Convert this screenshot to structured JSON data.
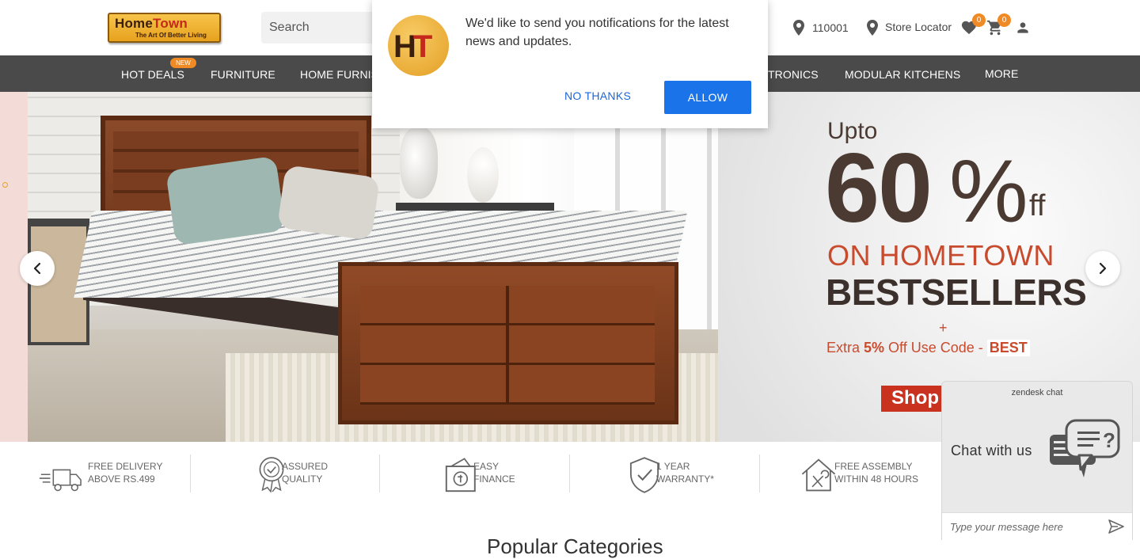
{
  "header": {
    "logo": {
      "name": "HomeTown",
      "name_part1": "Home",
      "name_part2": "Town",
      "tagline": "The Art Of Better Living"
    },
    "search_placeholder": "Search",
    "pincode": "110001",
    "store_locator": "Store Locator",
    "wishlist_count": "0",
    "cart_count": "0"
  },
  "nav": {
    "new_badge": "NEW",
    "items": [
      "HOT DEALS",
      "FURNITURE",
      "HOME FURNIS",
      "TRONICS",
      "MODULAR KITCHENS",
      "MORE"
    ]
  },
  "hero": {
    "promo": {
      "upto": "Upto",
      "percent": "60",
      "percent_sign": "%",
      "off": "ff",
      "line1": "ON HOMETOWN",
      "line2": "BESTSELLERS",
      "plus": "+",
      "extra_prefix": "Extra ",
      "extra_pct": "5%",
      "extra_mid": " Off Use Code - ",
      "code": "BEST",
      "shop": "Shop"
    }
  },
  "features": [
    {
      "icon": "truck-icon",
      "line1": "FREE DELIVERY",
      "line2": "ABOVE RS.499"
    },
    {
      "icon": "quality-badge-icon",
      "line1": "ASSURED",
      "line2": "QUALITY"
    },
    {
      "icon": "finance-icon",
      "line1": "EASY",
      "line2": "FINANCE"
    },
    {
      "icon": "shield-check-icon",
      "line1": "1 YEAR",
      "line2": "WARRANTY*"
    },
    {
      "icon": "house-tools-icon",
      "line1": "FREE ASSEMBLY",
      "line2": "WITHIN 48 HOURS"
    }
  ],
  "section_title": "Popular Categories",
  "notification": {
    "logo_text_1": "H",
    "logo_text_2": "T",
    "message": "We'd like to send you notifications for the latest news and updates.",
    "no_thanks": "NO THANKS",
    "allow": "ALLOW"
  },
  "chat": {
    "brand": "zendesk chat",
    "label": "Chat with us",
    "input_placeholder": "Type your message here"
  },
  "colors": {
    "nav_bg": "#4a4a4a",
    "accent_orange": "#f08a24",
    "allow_blue": "#1a73e8",
    "promo_red": "#c94b2e"
  }
}
